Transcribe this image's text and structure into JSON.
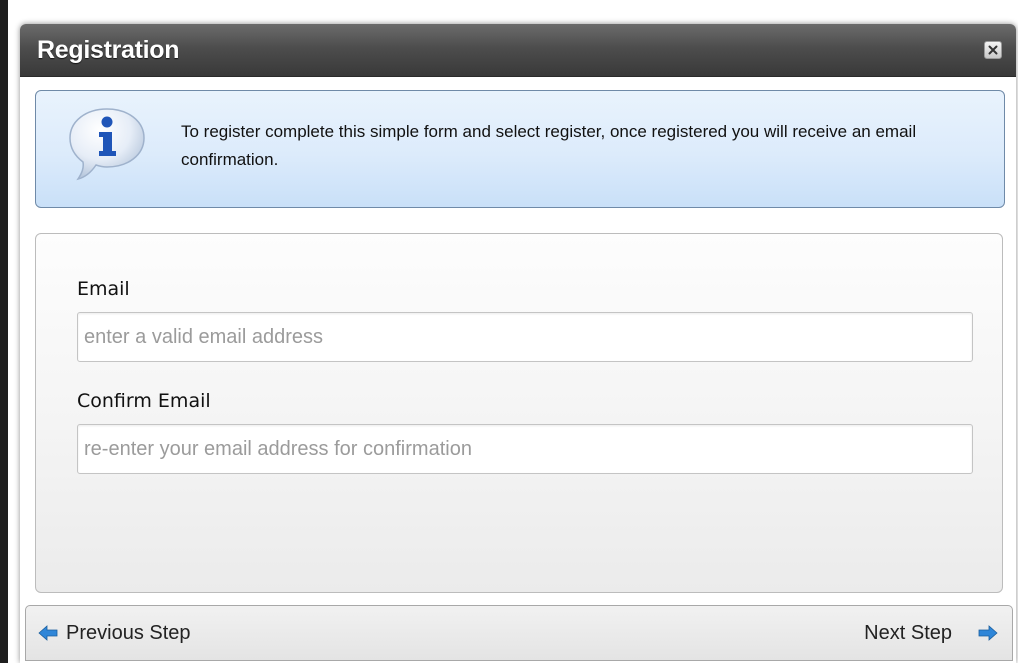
{
  "dialog": {
    "title": "Registration",
    "close_icon": "close-icon"
  },
  "info": {
    "icon": "info-speech-bubble-icon",
    "message": "To register complete this simple form and select register, once registered you will receive an email confirmation."
  },
  "form": {
    "email": {
      "label": "Email",
      "value": "",
      "placeholder": "enter a valid email address"
    },
    "confirm_email": {
      "label": "Confirm Email",
      "value": "",
      "placeholder": "re-enter your email address for confirmation"
    }
  },
  "footer": {
    "previous_label": "Previous Step",
    "previous_icon": "arrow-left-icon",
    "next_label": "Next Step",
    "next_icon": "arrow-right-icon"
  },
  "colors": {
    "titlebar": "#4d4d4d",
    "info_background": "#dcebfb",
    "arrow_blue": "#2f86d8"
  }
}
